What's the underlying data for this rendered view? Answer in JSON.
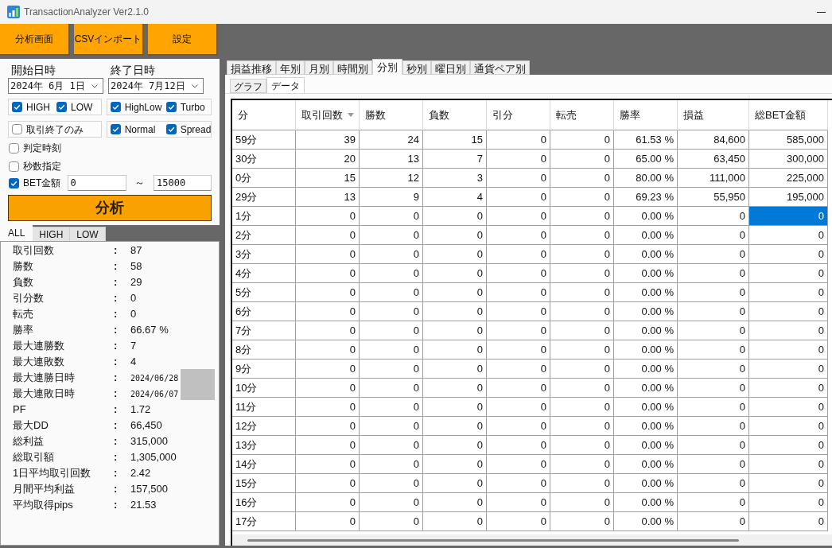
{
  "window": {
    "title": "TransactionAnalyzer Ver2.1.0"
  },
  "toolbar": [
    {
      "label": "分析画面"
    },
    {
      "label": "CSVインポート"
    },
    {
      "label": "設定"
    }
  ],
  "filters": {
    "start": {
      "label": "開始日時",
      "value": "2024年 6月 1日"
    },
    "end": {
      "label": "終了日時",
      "value": "2024年 7月12日"
    },
    "groups": [
      {
        "items": [
          {
            "label": "HIGH",
            "checked": true
          },
          {
            "label": "LOW",
            "checked": true
          }
        ]
      },
      {
        "items": [
          {
            "label": "HighLow",
            "checked": true
          },
          {
            "label": "Turbo",
            "checked": true
          }
        ]
      },
      {
        "items": [
          {
            "label": "取引終了のみ",
            "checked": false
          }
        ]
      },
      {
        "items": [
          {
            "label": "Normal",
            "checked": true
          },
          {
            "label": "Spread",
            "checked": true
          }
        ]
      }
    ],
    "options": [
      {
        "label": "判定時刻",
        "checked": false
      },
      {
        "label": "秒数指定",
        "checked": false
      }
    ],
    "bet": {
      "label": "BET金額",
      "checked": true,
      "min": "0",
      "separator": "～",
      "max": "15000"
    },
    "analyze_button": "分析"
  },
  "summary_tabs": [
    {
      "label": "ALL",
      "selected": true
    },
    {
      "label": "HIGH",
      "selected": false
    },
    {
      "label": "LOW",
      "selected": false
    }
  ],
  "summary": [
    {
      "label": "取引回数",
      "separator": ":",
      "value": "87",
      "kind": "text"
    },
    {
      "label": "勝数",
      "separator": ":",
      "value": "58",
      "kind": "text"
    },
    {
      "label": "負数",
      "separator": ":",
      "value": "29",
      "kind": "text"
    },
    {
      "label": "引分数",
      "separator": ":",
      "value": "0",
      "kind": "text"
    },
    {
      "label": "転売",
      "separator": ":",
      "value": "0",
      "kind": "text"
    },
    {
      "label": "勝率",
      "separator": ":",
      "value": "66.67 %",
      "kind": "text"
    },
    {
      "label": "最大連勝数",
      "separator": ":",
      "value": "7",
      "kind": "text"
    },
    {
      "label": "最大連敗数",
      "separator": ":",
      "value": "4",
      "kind": "text"
    },
    {
      "label": "最大連勝日時",
      "separator": ":",
      "value": "2024/06/28",
      "kind": "date"
    },
    {
      "label": "最大連敗日時",
      "separator": ":",
      "value": "2024/06/07",
      "kind": "date"
    },
    {
      "label": "PF",
      "separator": ":",
      "value": "1.72",
      "kind": "text"
    },
    {
      "label": "最大DD",
      "separator": ":",
      "value": "66,450",
      "kind": "text"
    },
    {
      "label": "総利益",
      "separator": ":",
      "value": "315,000",
      "kind": "text"
    },
    {
      "label": "総取引額",
      "separator": ":",
      "value": "1,305,000",
      "kind": "text"
    },
    {
      "label": "1日平均取引回数",
      "separator": ":",
      "value": "2.42",
      "kind": "text"
    },
    {
      "label": "月間平均利益",
      "separator": ":",
      "value": "157,500",
      "kind": "text"
    },
    {
      "label": "平均取得pips",
      "separator": ":",
      "value": "21.53",
      "kind": "text"
    }
  ],
  "view_tabs": [
    {
      "label": "損益推移",
      "selected": false
    },
    {
      "label": "年別",
      "selected": false
    },
    {
      "label": "月別",
      "selected": false
    },
    {
      "label": "時間別",
      "selected": false
    },
    {
      "label": "分別",
      "selected": true
    },
    {
      "label": "秒別",
      "selected": false
    },
    {
      "label": "曜日別",
      "selected": false
    },
    {
      "label": "通貨ペア別",
      "selected": false
    }
  ],
  "sub_tabs": [
    {
      "label": "グラフ",
      "selected": false
    },
    {
      "label": "データ",
      "selected": true
    }
  ],
  "table": {
    "columns": [
      {
        "label": "分",
        "sorted": false
      },
      {
        "label": "取引回数",
        "sorted": true
      },
      {
        "label": "勝数",
        "sorted": false
      },
      {
        "label": "負数",
        "sorted": false
      },
      {
        "label": "引分",
        "sorted": false
      },
      {
        "label": "転売",
        "sorted": false
      },
      {
        "label": "勝率",
        "sorted": false
      },
      {
        "label": "損益",
        "sorted": false
      },
      {
        "label": "総BET金額",
        "sorted": false
      }
    ],
    "rows": [
      {
        "cells": [
          {
            "text": "59分",
            "selected": false
          },
          {
            "text": "39",
            "selected": false
          },
          {
            "text": "24",
            "selected": false
          },
          {
            "text": "15",
            "selected": false
          },
          {
            "text": "0",
            "selected": false
          },
          {
            "text": "0",
            "selected": false
          },
          {
            "text": "61.53 %",
            "selected": false
          },
          {
            "text": "84,600",
            "selected": false
          },
          {
            "text": "585,000",
            "selected": false
          }
        ]
      },
      {
        "cells": [
          {
            "text": "30分",
            "selected": false
          },
          {
            "text": "20",
            "selected": false
          },
          {
            "text": "13",
            "selected": false
          },
          {
            "text": "7",
            "selected": false
          },
          {
            "text": "0",
            "selected": false
          },
          {
            "text": "0",
            "selected": false
          },
          {
            "text": "65.00 %",
            "selected": false
          },
          {
            "text": "63,450",
            "selected": false
          },
          {
            "text": "300,000",
            "selected": false
          }
        ]
      },
      {
        "cells": [
          {
            "text": "0分",
            "selected": false
          },
          {
            "text": "15",
            "selected": false
          },
          {
            "text": "12",
            "selected": false
          },
          {
            "text": "3",
            "selected": false
          },
          {
            "text": "0",
            "selected": false
          },
          {
            "text": "0",
            "selected": false
          },
          {
            "text": "80.00 %",
            "selected": false
          },
          {
            "text": "111,000",
            "selected": false
          },
          {
            "text": "225,000",
            "selected": false
          }
        ]
      },
      {
        "cells": [
          {
            "text": "29分",
            "selected": false
          },
          {
            "text": "13",
            "selected": false
          },
          {
            "text": "9",
            "selected": false
          },
          {
            "text": "4",
            "selected": false
          },
          {
            "text": "0",
            "selected": false
          },
          {
            "text": "0",
            "selected": false
          },
          {
            "text": "69.23 %",
            "selected": false
          },
          {
            "text": "55,950",
            "selected": false
          },
          {
            "text": "195,000",
            "selected": false
          }
        ]
      },
      {
        "cells": [
          {
            "text": "1分",
            "selected": false
          },
          {
            "text": "0",
            "selected": false
          },
          {
            "text": "0",
            "selected": false
          },
          {
            "text": "0",
            "selected": false
          },
          {
            "text": "0",
            "selected": false
          },
          {
            "text": "0",
            "selected": false
          },
          {
            "text": "0.00 %",
            "selected": false
          },
          {
            "text": "0",
            "selected": false
          },
          {
            "text": "0",
            "selected": true
          }
        ]
      },
      {
        "cells": [
          {
            "text": "2分",
            "selected": false
          },
          {
            "text": "0",
            "selected": false
          },
          {
            "text": "0",
            "selected": false
          },
          {
            "text": "0",
            "selected": false
          },
          {
            "text": "0",
            "selected": false
          },
          {
            "text": "0",
            "selected": false
          },
          {
            "text": "0.00 %",
            "selected": false
          },
          {
            "text": "0",
            "selected": false
          },
          {
            "text": "0",
            "selected": false
          }
        ]
      },
      {
        "cells": [
          {
            "text": "3分",
            "selected": false
          },
          {
            "text": "0",
            "selected": false
          },
          {
            "text": "0",
            "selected": false
          },
          {
            "text": "0",
            "selected": false
          },
          {
            "text": "0",
            "selected": false
          },
          {
            "text": "0",
            "selected": false
          },
          {
            "text": "0.00 %",
            "selected": false
          },
          {
            "text": "0",
            "selected": false
          },
          {
            "text": "0",
            "selected": false
          }
        ]
      },
      {
        "cells": [
          {
            "text": "4分",
            "selected": false
          },
          {
            "text": "0",
            "selected": false
          },
          {
            "text": "0",
            "selected": false
          },
          {
            "text": "0",
            "selected": false
          },
          {
            "text": "0",
            "selected": false
          },
          {
            "text": "0",
            "selected": false
          },
          {
            "text": "0.00 %",
            "selected": false
          },
          {
            "text": "0",
            "selected": false
          },
          {
            "text": "0",
            "selected": false
          }
        ]
      },
      {
        "cells": [
          {
            "text": "5分",
            "selected": false
          },
          {
            "text": "0",
            "selected": false
          },
          {
            "text": "0",
            "selected": false
          },
          {
            "text": "0",
            "selected": false
          },
          {
            "text": "0",
            "selected": false
          },
          {
            "text": "0",
            "selected": false
          },
          {
            "text": "0.00 %",
            "selected": false
          },
          {
            "text": "0",
            "selected": false
          },
          {
            "text": "0",
            "selected": false
          }
        ]
      },
      {
        "cells": [
          {
            "text": "6分",
            "selected": false
          },
          {
            "text": "0",
            "selected": false
          },
          {
            "text": "0",
            "selected": false
          },
          {
            "text": "0",
            "selected": false
          },
          {
            "text": "0",
            "selected": false
          },
          {
            "text": "0",
            "selected": false
          },
          {
            "text": "0.00 %",
            "selected": false
          },
          {
            "text": "0",
            "selected": false
          },
          {
            "text": "0",
            "selected": false
          }
        ]
      },
      {
        "cells": [
          {
            "text": "7分",
            "selected": false
          },
          {
            "text": "0",
            "selected": false
          },
          {
            "text": "0",
            "selected": false
          },
          {
            "text": "0",
            "selected": false
          },
          {
            "text": "0",
            "selected": false
          },
          {
            "text": "0",
            "selected": false
          },
          {
            "text": "0.00 %",
            "selected": false
          },
          {
            "text": "0",
            "selected": false
          },
          {
            "text": "0",
            "selected": false
          }
        ]
      },
      {
        "cells": [
          {
            "text": "8分",
            "selected": false
          },
          {
            "text": "0",
            "selected": false
          },
          {
            "text": "0",
            "selected": false
          },
          {
            "text": "0",
            "selected": false
          },
          {
            "text": "0",
            "selected": false
          },
          {
            "text": "0",
            "selected": false
          },
          {
            "text": "0.00 %",
            "selected": false
          },
          {
            "text": "0",
            "selected": false
          },
          {
            "text": "0",
            "selected": false
          }
        ]
      },
      {
        "cells": [
          {
            "text": "9分",
            "selected": false
          },
          {
            "text": "0",
            "selected": false
          },
          {
            "text": "0",
            "selected": false
          },
          {
            "text": "0",
            "selected": false
          },
          {
            "text": "0",
            "selected": false
          },
          {
            "text": "0",
            "selected": false
          },
          {
            "text": "0.00 %",
            "selected": false
          },
          {
            "text": "0",
            "selected": false
          },
          {
            "text": "0",
            "selected": false
          }
        ]
      },
      {
        "cells": [
          {
            "text": "10分",
            "selected": false
          },
          {
            "text": "0",
            "selected": false
          },
          {
            "text": "0",
            "selected": false
          },
          {
            "text": "0",
            "selected": false
          },
          {
            "text": "0",
            "selected": false
          },
          {
            "text": "0",
            "selected": false
          },
          {
            "text": "0.00 %",
            "selected": false
          },
          {
            "text": "0",
            "selected": false
          },
          {
            "text": "0",
            "selected": false
          }
        ]
      },
      {
        "cells": [
          {
            "text": "11分",
            "selected": false
          },
          {
            "text": "0",
            "selected": false
          },
          {
            "text": "0",
            "selected": false
          },
          {
            "text": "0",
            "selected": false
          },
          {
            "text": "0",
            "selected": false
          },
          {
            "text": "0",
            "selected": false
          },
          {
            "text": "0.00 %",
            "selected": false
          },
          {
            "text": "0",
            "selected": false
          },
          {
            "text": "0",
            "selected": false
          }
        ]
      },
      {
        "cells": [
          {
            "text": "12分",
            "selected": false
          },
          {
            "text": "0",
            "selected": false
          },
          {
            "text": "0",
            "selected": false
          },
          {
            "text": "0",
            "selected": false
          },
          {
            "text": "0",
            "selected": false
          },
          {
            "text": "0",
            "selected": false
          },
          {
            "text": "0.00 %",
            "selected": false
          },
          {
            "text": "0",
            "selected": false
          },
          {
            "text": "0",
            "selected": false
          }
        ]
      },
      {
        "cells": [
          {
            "text": "13分",
            "selected": false
          },
          {
            "text": "0",
            "selected": false
          },
          {
            "text": "0",
            "selected": false
          },
          {
            "text": "0",
            "selected": false
          },
          {
            "text": "0",
            "selected": false
          },
          {
            "text": "0",
            "selected": false
          },
          {
            "text": "0.00 %",
            "selected": false
          },
          {
            "text": "0",
            "selected": false
          },
          {
            "text": "0",
            "selected": false
          }
        ]
      },
      {
        "cells": [
          {
            "text": "14分",
            "selected": false
          },
          {
            "text": "0",
            "selected": false
          },
          {
            "text": "0",
            "selected": false
          },
          {
            "text": "0",
            "selected": false
          },
          {
            "text": "0",
            "selected": false
          },
          {
            "text": "0",
            "selected": false
          },
          {
            "text": "0.00 %",
            "selected": false
          },
          {
            "text": "0",
            "selected": false
          },
          {
            "text": "0",
            "selected": false
          }
        ]
      },
      {
        "cells": [
          {
            "text": "15分",
            "selected": false
          },
          {
            "text": "0",
            "selected": false
          },
          {
            "text": "0",
            "selected": false
          },
          {
            "text": "0",
            "selected": false
          },
          {
            "text": "0",
            "selected": false
          },
          {
            "text": "0",
            "selected": false
          },
          {
            "text": "0.00 %",
            "selected": false
          },
          {
            "text": "0",
            "selected": false
          },
          {
            "text": "0",
            "selected": false
          }
        ]
      },
      {
        "cells": [
          {
            "text": "16分",
            "selected": false
          },
          {
            "text": "0",
            "selected": false
          },
          {
            "text": "0",
            "selected": false
          },
          {
            "text": "0",
            "selected": false
          },
          {
            "text": "0",
            "selected": false
          },
          {
            "text": "0",
            "selected": false
          },
          {
            "text": "0.00 %",
            "selected": false
          },
          {
            "text": "0",
            "selected": false
          },
          {
            "text": "0",
            "selected": false
          }
        ]
      },
      {
        "cells": [
          {
            "text": "17分",
            "selected": false
          },
          {
            "text": "0",
            "selected": false
          },
          {
            "text": "0",
            "selected": false
          },
          {
            "text": "0",
            "selected": false
          },
          {
            "text": "0",
            "selected": false
          },
          {
            "text": "0",
            "selected": false
          },
          {
            "text": "0.00 %",
            "selected": false
          },
          {
            "text": "0",
            "selected": false
          },
          {
            "text": "0",
            "selected": false
          }
        ]
      }
    ]
  }
}
